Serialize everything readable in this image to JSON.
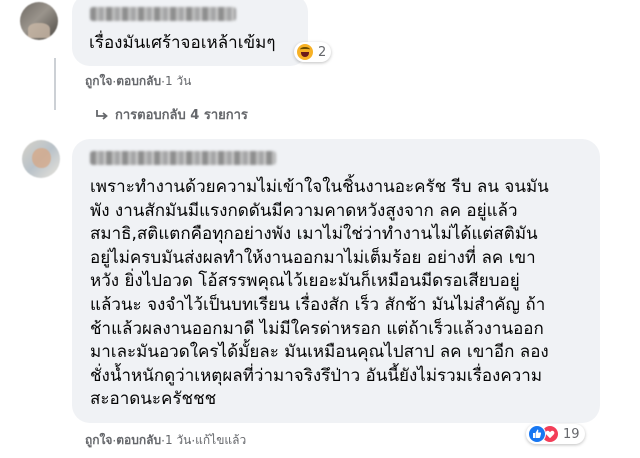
{
  "comment1": {
    "text": "เรื่องมันเศร้าจอเหล้าเข้มๆ",
    "reaction_count": "2",
    "actions": {
      "like": "ถูกใจ",
      "reply": "ตอบกลับ",
      "sep": " · ",
      "time": "1 วัน"
    }
  },
  "replies_link": {
    "label": "การตอบกลับ 4 รายการ"
  },
  "comment2": {
    "lines": [
      "เพราะทำงานด้วยความไม่เข้าใจในชิ้นงานอะครัช รีบ ลน จนมัน",
      "พัง งานสักมันมีแรงกดดันมีความคาดหวังสูงจาก ลค อยู่แล้ว",
      "สมาธิ,สติแตกคือทุกอย่างพัง เมาไม่ใช่ว่าทำงานไม่ได้แต่สติมัน",
      "อยู่ไม่ครบมันส่งผลทำให้งานออกมาไม่เต็มร้อย อย่างที่ ลค เขา",
      "หวัง ยิ่งไปอวด โอ้สรรพคุณไว้เยอะมันก็เหมือนมีดรอเสียบอยู่",
      "แล้วนะ จงจำไว้เป็นบทเรียน เรื่องสัก เร็ว สักช้า มันไม่สำคัญ ถ้า",
      "ช้าแล้วผลงานออกมาดี ไม่มีใครด่าหรอก แต่ถ้าเร็วแล้วงานออก",
      "มาเละมันอวดใครได้มั้ยละ มันเหมือนคุณไปสาป ลค เขาอีก ลอง",
      "ชั่งน้ำหนักดูว่าเหตุผลที่ว่ามาจริงรึป่าว อันนี้ยังไม่รวมเรื่องความ",
      "สะอาดนะครัชชช"
    ],
    "reaction_count": "19",
    "actions": {
      "like": "ถูกใจ",
      "reply": "ตอบกลับ",
      "sep": " · ",
      "time": "1 วัน",
      "edited": "แก้ไขแล้ว"
    }
  },
  "colors": {
    "bubble": "#f0f2f5",
    "meta": "#65676b",
    "like_blue": "#1877f2",
    "love_red": "#f33e58",
    "haha_yellow": "#f7b125"
  }
}
